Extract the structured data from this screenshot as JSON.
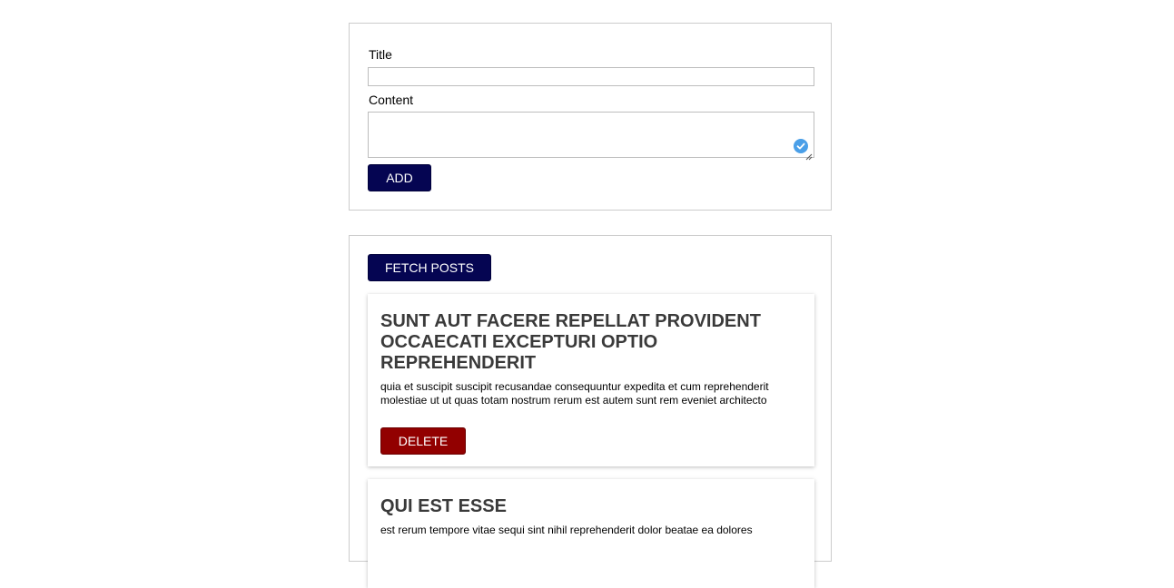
{
  "form": {
    "title_label": "Title",
    "title_value": "",
    "content_label": "Content",
    "content_value": "",
    "add_button": "ADD"
  },
  "posts_panel": {
    "fetch_button": "FETCH POSTS",
    "posts": [
      {
        "title": "SUNT AUT FACERE REPELLAT PROVIDENT OCCAECATI EXCEPTURI OPTIO REPREHENDERIT",
        "body": "quia et suscipit suscipit recusandae consequuntur expedita et cum reprehenderit molestiae ut ut quas totam nostrum rerum est autem sunt rem eveniet architecto",
        "delete_button": "DELETE"
      },
      {
        "title": "QUI EST ESSE",
        "body": "est rerum tempore vitae sequi sint nihil reprehenderit dolor beatae ea dolores"
      }
    ]
  },
  "colors": {
    "primary_button": "#050552",
    "delete_button": "#920000",
    "border": "#cccccc",
    "post_title": "#3a3a3a",
    "grammar_badge": "#4a9fe8"
  },
  "icons": {
    "resize": "resize-handle-icon",
    "grammar": "grammar-check-icon"
  }
}
